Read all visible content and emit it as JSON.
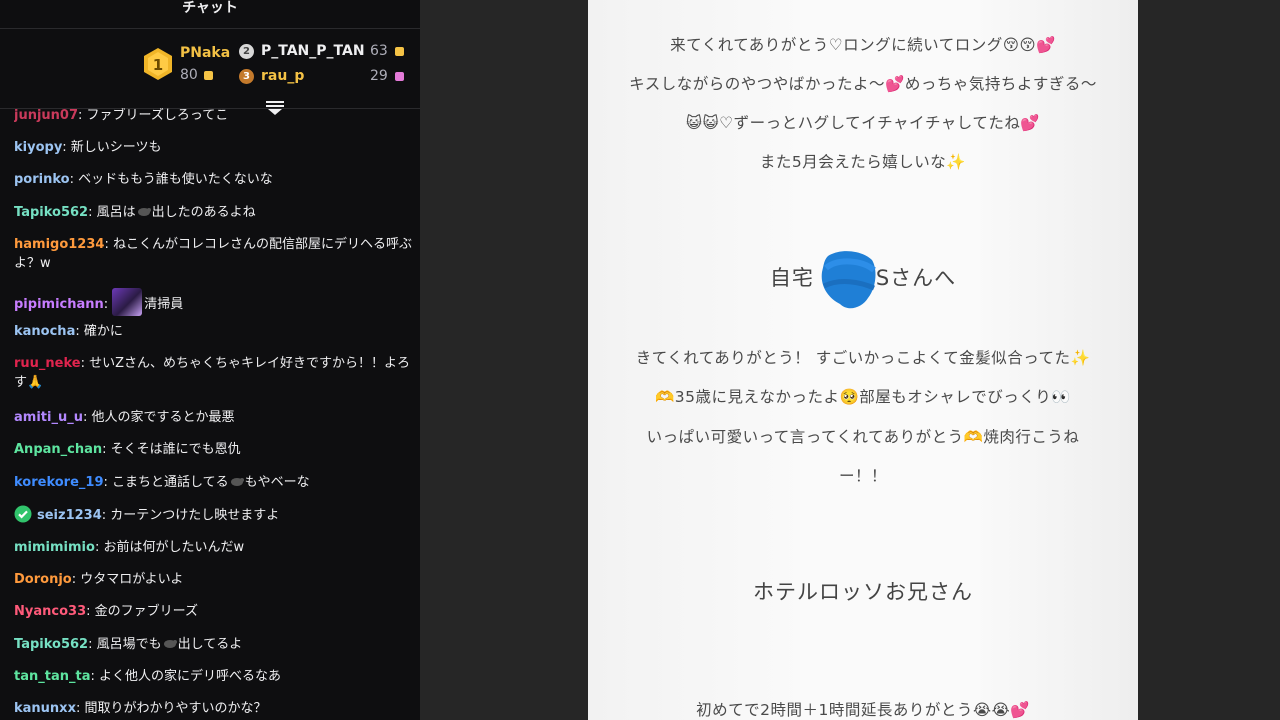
{
  "chat": {
    "title": "チャット",
    "leaderboard": {
      "first": {
        "rank": "1",
        "name": "PNaka",
        "score": "80"
      },
      "second": {
        "rank": "2",
        "name": "P_TAN_P_TAN",
        "score": "63"
      },
      "third": {
        "rank": "3",
        "name": "rau_p",
        "score": "29"
      }
    },
    "messages": [
      {
        "user": "junjun07",
        "text": ": ファブリーズしろってこ",
        "color": "#c93a5b"
      },
      {
        "user": "kiyopy",
        "text": ": 新しいシーツも",
        "color": "#9cc4f2"
      },
      {
        "user": "porinko",
        "text": ": ベッドももう誰も使いたくないな",
        "color": "#9cc4f2"
      },
      {
        "user": "Tapiko562",
        "text_pre": ": 風呂は",
        "text_post": "出したのあるよね",
        "color": "#76e0c3"
      },
      {
        "user": "hamigo1234",
        "text": ": ねこくんがコレコレさんの配信部屋にデリヘる呼ぶ",
        "cont": "よ？w",
        "color": "#ff9a3d"
      },
      {
        "user": "pipimichann",
        "text": "清掃員",
        "color": "#c77dff"
      },
      {
        "user": "kanocha",
        "text": ": 確かに",
        "color": "#9cc4f2"
      },
      {
        "user": "ruu_neke",
        "text": ": せいZさん、めちゃくちゃキレイ好きですから！！よろ",
        "cont": "す🙏",
        "color": "#e0244e"
      },
      {
        "user": "amiti_u_u",
        "text": ": 他人の家でするとか最悪",
        "color": "#b388ff"
      },
      {
        "user": "Anpan_chan",
        "text": ": そくそは誰にでも恩仇",
        "color": "#5ee5a0"
      },
      {
        "user": "korekore_19",
        "text_pre": ": こまちと通話してる",
        "text_post": "もやベーな",
        "color": "#3f8cff"
      },
      {
        "user": "seiz1234",
        "text": ": カーテンつけたし映せますよ",
        "color": "#9cc4f2"
      },
      {
        "user": "mimimimio",
        "text": ": お前は何がしたいんだw",
        "color": "#76e0c3"
      },
      {
        "user": "Doronjo",
        "text": ": ウタマロがよいよ",
        "color": "#ff9a3d"
      },
      {
        "user": "Nyanco33",
        "text": ": 金のファブリーズ",
        "color": "#ff5a7a"
      },
      {
        "user": "Tapiko562",
        "text_pre": ": 風呂場でも",
        "text_post": "出してるよ",
        "color": "#76e0c3"
      },
      {
        "user": "tan_tan_ta",
        "text": ": よく他人の家にデリ呼べるなあ",
        "color": "#5ee5a0"
      },
      {
        "user": "kanunxx",
        "text": ": 間取りがわかりやすいのかな？",
        "color": "#9cc4f2"
      }
    ]
  },
  "letter": {
    "line1": "来てくれてありがとう♡ロングに続いてロング😚😚💕",
    "line2": "キスしながらのやつやばかったよ〜💕めっちゃ気持ちよすぎる〜",
    "line3": "😺😺♡ずーっとハグしてイチャイチャしてたね💕",
    "line4": "また5月会えたら嬉しいな✨",
    "heading1_pre": "自宅",
    "heading1_post": "Sさんへ",
    "line5": "きてくれてありがとう！ すごいかっこよくて金髪似合ってた✨",
    "line6": "🫶35歳に見えなかったよ🥺部屋もオシャレでびっくり👀",
    "line7": "いっぱい可愛いって言ってくれてありがとう🫶焼肉行こうね",
    "line8": "ー！！",
    "heading2": "ホテルロッソお兄さん",
    "line9": "初めてで2時間＋1時間延長ありがとう😭😭💕"
  }
}
